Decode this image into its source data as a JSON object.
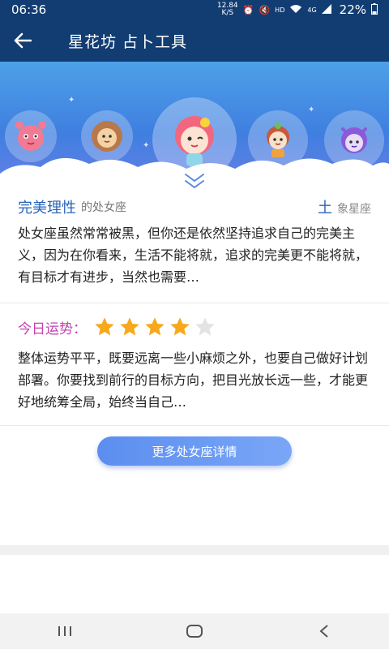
{
  "status_bar": {
    "time": "06:36",
    "net_speed": "12.84 K/S",
    "hd": "HD",
    "signal": "4G",
    "battery": "22%"
  },
  "app_bar": {
    "title": "星花坊 占卜工具"
  },
  "hero": {
    "avatars": [
      {
        "icon": "cancer-character-icon"
      },
      {
        "icon": "leo-character-icon"
      },
      {
        "icon": "virgo-character-icon",
        "selected": true
      },
      {
        "icon": "libra-character-icon"
      },
      {
        "icon": "scorpio-character-icon"
      }
    ]
  },
  "personality": {
    "trait": "完美理性",
    "sign_label": "的处女座",
    "element": "土",
    "element_label": "象星座",
    "text": "处女座虽然常常被黑，但你还是依然坚持追求自己的完美主义，因为在你看来，生活不能将就，追求的完美更不能将就，有目标才有进步，当然也需要…"
  },
  "fortune": {
    "label": "今日运势：",
    "stars": 4,
    "max_stars": 5,
    "text": "整体运势平平，既要远离一些小麻烦之外，也要自己做好计划部署。你要找到前行的目标方向，把目光放长远一些，才能更好地统筹全局，始终当自己…"
  },
  "more_button": {
    "label": "更多处女座详情"
  },
  "colors": {
    "header": "#123d72",
    "accent_blue": "#2a65b8",
    "fortune_pink": "#c33fb2",
    "star_gold": "#f7a81b",
    "star_empty": "#e3e3e3"
  }
}
